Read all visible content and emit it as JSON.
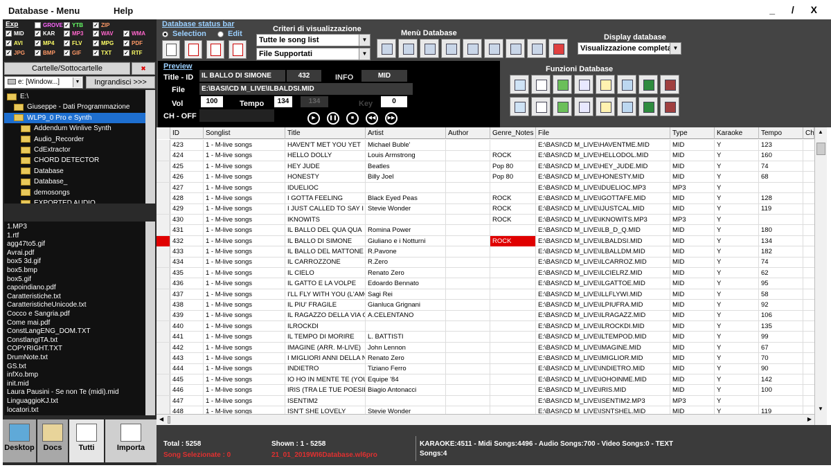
{
  "menu": {
    "database": "Database - Menu",
    "help": "Help",
    "controls": "_ / X"
  },
  "left": {
    "exp_label": "Exp",
    "filters": [
      {
        "label": "MID",
        "checked": true,
        "color": "#ffffff"
      },
      {
        "label": "GROVE",
        "checked": false,
        "color": "#ff66ff"
      },
      {
        "label": "YTB",
        "checked": true,
        "color": "#66ff66"
      },
      {
        "label": "ZIP",
        "checked": true,
        "color": "#ff9966"
      },
      {
        "label": "KAR",
        "checked": true,
        "color": "#ffffff"
      },
      {
        "label": "MP3",
        "checked": true,
        "color": "#ff66cc"
      },
      {
        "label": "WAV",
        "checked": true,
        "color": "#ff66cc"
      },
      {
        "label": "WMA",
        "checked": true,
        "color": "#ff66cc"
      },
      {
        "label": "AVI",
        "checked": true,
        "color": "#ffff66"
      },
      {
        "label": "MP4",
        "checked": true,
        "color": "#ffff66"
      },
      {
        "label": "FLV",
        "checked": true,
        "color": "#ffff66"
      },
      {
        "label": "MPG",
        "checked": true,
        "color": "#ffff66"
      },
      {
        "label": "PDF",
        "checked": true,
        "color": "#ff9966"
      },
      {
        "label": "JPG",
        "checked": true,
        "color": "#ff9966"
      },
      {
        "label": "BMP",
        "checked": true,
        "color": "#ff9966"
      },
      {
        "label": "GIF",
        "checked": true,
        "color": "#ff9966"
      },
      {
        "label": "TXT",
        "checked": true,
        "color": "#ffff66"
      },
      {
        "label": "RTF",
        "checked": true,
        "color": "#ffff66"
      }
    ],
    "cartelle_label": "Cartelle/Sottocartelle",
    "cartelle_close": "✖",
    "drive_value": "e: [Window...]",
    "ingrandisci": "Ingrandisci >>>",
    "folders": [
      {
        "name": "E:\\",
        "indent": 0,
        "selected": false
      },
      {
        "name": "Giuseppe - Dati Programmazione",
        "indent": 1,
        "selected": false
      },
      {
        "name": "WLP9_0 Pro e Synth",
        "indent": 1,
        "selected": true
      },
      {
        "name": "Addendum Winlive Synth",
        "indent": 2,
        "selected": false
      },
      {
        "name": "Audio_Recorder",
        "indent": 2,
        "selected": false
      },
      {
        "name": "CdExtractor",
        "indent": 2,
        "selected": false
      },
      {
        "name": "CHORD DETECTOR",
        "indent": 2,
        "selected": false
      },
      {
        "name": "Database",
        "indent": 2,
        "selected": false
      },
      {
        "name": "Database_",
        "indent": 2,
        "selected": false
      },
      {
        "name": "demosongs",
        "indent": 2,
        "selected": false
      },
      {
        "name": "EXPORTED AUDIO",
        "indent": 2,
        "selected": false
      }
    ],
    "files": [
      "1.MP3",
      "1.rtf",
      "agg47to5.gif",
      "Avrai.pdf",
      "box5 3d.gif",
      "box5.bmp",
      "box5.gif",
      "capoindiano.pdf",
      "Caratteristiche.txt",
      "CaratteristicheUnicode.txt",
      "Cocco e Sangria.pdf",
      "Come mai.pdf",
      "ConstLangENG_DOM.TXT",
      "ConstlangITA.txt",
      "COPYRIGHT.TXT",
      "DrumNote.txt",
      "GS.txt",
      "infXo.bmp",
      "init.mid",
      "Laura Pausini - Se non Te (midi).mid",
      "LinguaggioKJ.txt",
      "locatori.txt"
    ],
    "tabs": [
      {
        "label": "Desktop",
        "icon": "desktop-icon"
      },
      {
        "label": "Docs",
        "icon": "docs-icon"
      },
      {
        "label": "Tutti",
        "icon": "all-files-icon"
      },
      {
        "label": "Importa",
        "icon": "import-icon"
      }
    ]
  },
  "top": {
    "status_bar_label": "Database status bar",
    "radio_selection": "Selection",
    "radio_edit": "Edit",
    "criteri_title": "Criteri di visualizzazione",
    "criteri_combo1": "Tutte le song list",
    "criteri_combo2": "File Supportati",
    "menu_db_title": "Menù Database",
    "display_title": "Display database",
    "display_value": "Visualizzazione completa",
    "funzioni_title": "Funzioni Database"
  },
  "preview": {
    "label": "Preview",
    "title_id_label": "Title - ID",
    "title_value": "IL BALLO DI SIMONE",
    "id_value": "432",
    "info_label": "INFO",
    "info_value": "MID",
    "file_label": "File",
    "file_value": "E:\\BASI\\CD M_LIVE\\ILBALDSI.MID",
    "vol_label": "Vol",
    "vol_value": "100",
    "tempo_label": "Tempo",
    "tempo_value": "134",
    "tempo_alt": "134",
    "key_label": "Key",
    "key_value": "0",
    "choff_label": "CH - OFF"
  },
  "grid": {
    "columns": [
      "ID",
      "Songlist",
      "Title",
      "Artist",
      "Author",
      "Genre_Notes",
      "File",
      "Type",
      "Karaoke",
      "Tempo",
      "Ch"
    ],
    "rows": [
      [
        "423",
        "1 - M-live songs",
        "HAVEN'T MET YOU YET",
        "Michael Buble'",
        "",
        "",
        "E:\\BASI\\CD M_LIVE\\HAVENTME.MID",
        "MID",
        "Y",
        "123"
      ],
      [
        "424",
        "1 - M-live songs",
        "HELLO DOLLY",
        "Louis Armstrong",
        "",
        "ROCK",
        "E:\\BASI\\CD M_LIVE\\HELLODOL.MID",
        "MID",
        "Y",
        "160"
      ],
      [
        "425",
        "1 - M-live songs",
        "HEY JUDE",
        "Beatles",
        "",
        "Pop 80",
        "E:\\BASI\\CD M_LIVE\\HEY_JUDE.MID",
        "MID",
        "Y",
        "74"
      ],
      [
        "426",
        "1 - M-live songs",
        "HONESTY",
        "Billy Joel",
        "",
        "Pop 80",
        "E:\\BASI\\CD M_LIVE\\HONESTY.MID",
        "MID",
        "Y",
        "68"
      ],
      [
        "427",
        "1 - M-live songs",
        "IDUELIOC",
        "",
        "",
        "",
        "E:\\BASI\\CD M_LIVE\\IDUELIOC.MP3",
        "MP3",
        "Y",
        ""
      ],
      [
        "428",
        "1 - M-live songs",
        "I GOTTA FEELING",
        "Black Eyed Peas",
        "",
        "ROCK",
        "E:\\BASI\\CD M_LIVE\\IGOTTAFE.MID",
        "MID",
        "Y",
        "128"
      ],
      [
        "429",
        "1 - M-live songs",
        "I JUST CALLED TO SAY I LOV",
        "Stevie Wonder",
        "",
        "ROCK",
        "E:\\BASI\\CD M_LIVE\\IJUSTCAL.MID",
        "MID",
        "Y",
        "119"
      ],
      [
        "430",
        "1 - M-live songs",
        "IKNOWITS",
        "",
        "",
        "ROCK",
        "E:\\BASI\\CD M_LIVE\\IKNOWITS.MP3",
        "MP3",
        "Y",
        ""
      ],
      [
        "431",
        "1 - M-live songs",
        "IL BALLO DEL QUA QUA",
        "Romina Power",
        "",
        "",
        "E:\\BASI\\CD M_LIVE\\ILB_D_Q.MID",
        "MID",
        "Y",
        "180"
      ],
      [
        "432",
        "1 - M-live songs",
        "IL BALLO DI SIMONE",
        "Giuliano e i Notturni",
        "",
        "ROCK",
        "E:\\BASI\\CD M_LIVE\\ILBALDSI.MID",
        "MID",
        "Y",
        "134"
      ],
      [
        "433",
        "1 - M-live songs",
        "IL BALLO DEL MATTONE",
        "R.Pavone",
        "",
        "",
        "E:\\BASI\\CD M_LIVE\\ILBALLDM.MID",
        "MID",
        "Y",
        "182"
      ],
      [
        "434",
        "1 - M-live songs",
        "IL CARROZZONE",
        "R.Zero",
        "",
        "",
        "E:\\BASI\\CD M_LIVE\\ILCARROZ.MID",
        "MID",
        "Y",
        "74"
      ],
      [
        "435",
        "1 - M-live songs",
        "IL CIELO",
        "Renato Zero",
        "",
        "",
        "E:\\BASI\\CD M_LIVE\\ILCIELRZ.MID",
        "MID",
        "Y",
        "62"
      ],
      [
        "436",
        "1 - M-live songs",
        "IL GATTO E LA VOLPE",
        "Edoardo Bennato",
        "",
        "",
        "E:\\BASI\\CD M_LIVE\\ILGATTOE.MID",
        "MID",
        "Y",
        "95"
      ],
      [
        "437",
        "1 - M-live songs",
        "I'LL FLY WITH YOU (L'AMO",
        "Sagi Rei",
        "",
        "",
        "E:\\BASI\\CD M_LIVE\\ILLFLYWI.MID",
        "MID",
        "Y",
        "58"
      ],
      [
        "438",
        "1 - M-live songs",
        "IL PIU' FRAGILE",
        "Gianluca Grignani",
        "",
        "",
        "E:\\BASI\\CD M_LIVE\\ILPIUFRA.MID",
        "MID",
        "Y",
        "92"
      ],
      [
        "439",
        "1 - M-live songs",
        "IL RAGAZZO DELLA VIA GL",
        "A.CELENTANO",
        "",
        "",
        "E:\\BASI\\CD M_LIVE\\ILRAGAZZ.MID",
        "MID",
        "Y",
        "106"
      ],
      [
        "440",
        "1 - M-live songs",
        "ILROCKDI",
        "",
        "",
        "",
        "E:\\BASI\\CD M_LIVE\\ILROCKDI.MID",
        "MID",
        "Y",
        "135"
      ],
      [
        "441",
        "1 - M-live songs",
        "IL TEMPO DI MORIRE",
        "L. BATTISTI",
        "",
        "",
        "E:\\BASI\\CD M_LIVE\\ILTEMPOD.MID",
        "MID",
        "Y",
        "99"
      ],
      [
        "442",
        "1 - M-live songs",
        "IMAGINE (ARR. M-LIVE)",
        "John Lennon",
        "",
        "",
        "E:\\BASI\\CD M_LIVE\\IMAGINE.MID",
        "MID",
        "Y",
        "67"
      ],
      [
        "443",
        "1 - M-live songs",
        "I MIGLIORI ANNI DELLA N",
        "Renato Zero",
        "",
        "",
        "E:\\BASI\\CD M_LIVE\\IMIGLIOR.MID",
        "MID",
        "Y",
        "70"
      ],
      [
        "444",
        "1 - M-live songs",
        "INDIETRO",
        "Tiziano Ferro",
        "",
        "",
        "E:\\BASI\\CD M_LIVE\\INDIETRO.MID",
        "MID",
        "Y",
        "90"
      ],
      [
        "445",
        "1 - M-live songs",
        "IO HO IN MENTE TE (YOU V",
        "Equipe '84",
        "",
        "",
        "E:\\BASI\\CD M_LIVE\\IOHOINME.MID",
        "MID",
        "Y",
        "142"
      ],
      [
        "446",
        "1 - M-live songs",
        "IRIS (TRA LE TUE POESIE)",
        "Biagio Antonacci",
        "",
        "",
        "E:\\BASI\\CD M_LIVE\\IRIS.MID",
        "MID",
        "Y",
        "100"
      ],
      [
        "447",
        "1 - M-live songs",
        "ISENTIM2",
        "",
        "",
        "",
        "E:\\BASI\\CD M_LIVE\\ISENTIM2.MP3",
        "MP3",
        "Y",
        ""
      ],
      [
        "448",
        "1 - M-live songs",
        "ISN'T SHE LOVELY",
        "Stevie Wonder",
        "",
        "",
        "E:\\BASI\\CD M_LIVE\\ISNTSHEL.MID",
        "MID",
        "Y",
        "119"
      ]
    ],
    "selected_id": "432"
  },
  "footer": {
    "total": "Total :  5258",
    "song_selezionate": "Song Selezionate : 0",
    "shown": "Shown :  1 - 5258",
    "db_file": "21_01_2019WI6Database.wl6pro",
    "stats_line1": "KARAOKE:4511 - Midi Songs:4496 - Audio Songs:700 - Video Songs:0 - TEXT",
    "stats_line2": "Songs:4"
  },
  "colors": {
    "accent_blue": "#1e6fd0",
    "selected_red": "#e00000",
    "panel_dark": "#2a2a2a"
  }
}
